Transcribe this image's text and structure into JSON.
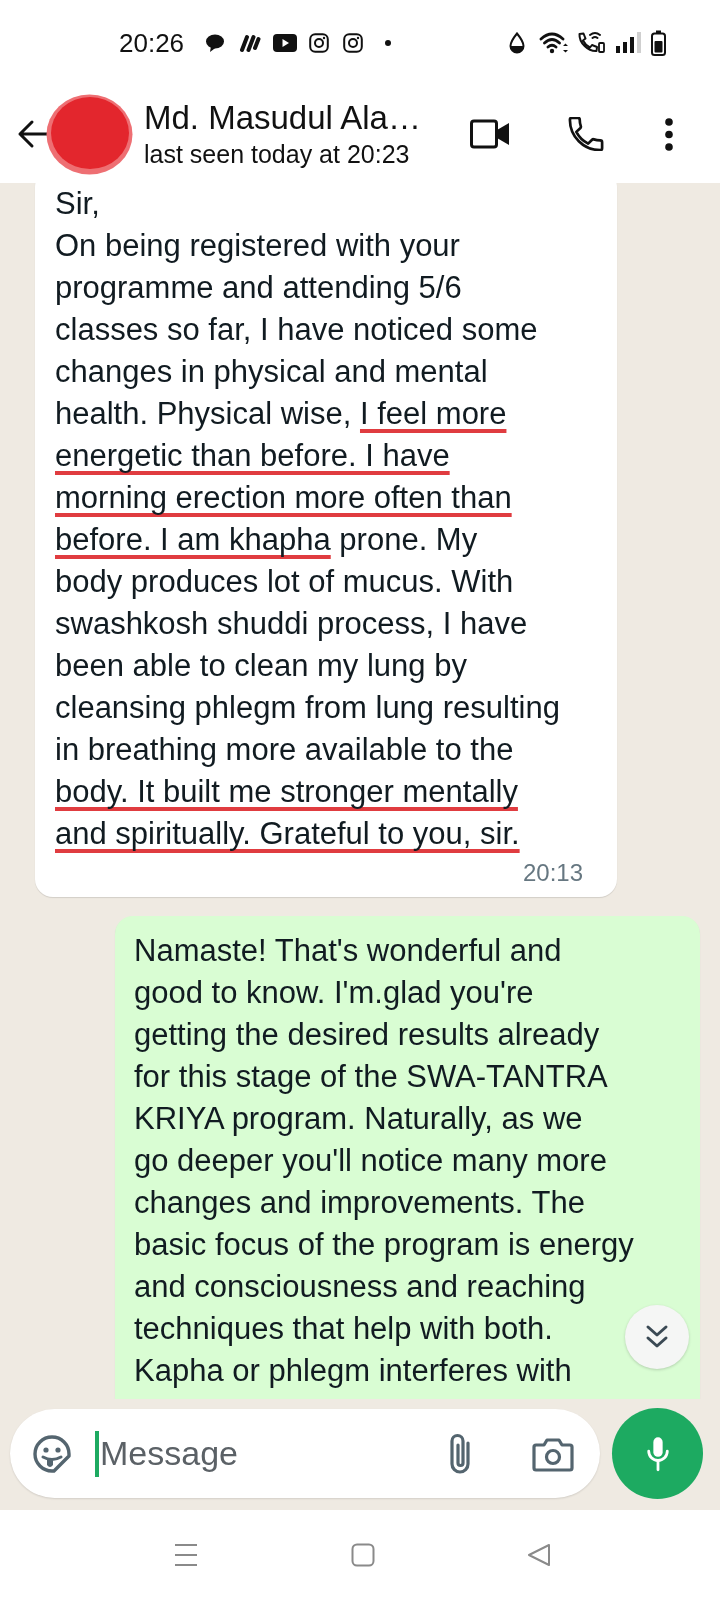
{
  "status_bar": {
    "time": "20:26"
  },
  "header": {
    "contact_name": "Md. Masudul Ala…",
    "status": "last seen today at 20:23"
  },
  "messages": [
    {
      "kind": "incoming",
      "segments": [
        {
          "text": "Sir,\nOn being registered with your\nprogramme and attending 5/6\nclasses so far, I have noticed some\nchanges in physical and mental\nhealth. Physical wise, ",
          "underlined": false
        },
        {
          "text": "I feel more\nenergetic than before. I have\nmorning erection more often than\nbefore. I am khapha",
          "underlined": true
        },
        {
          "text": " prone. My\nbody produces lot of mucus. With\nswashkosh shuddi process, I have\nbeen able to clean my lung by\ncleansing phlegm from lung resulting\nin breathing more available to the\n",
          "underlined": false
        },
        {
          "text": "body. It built me stronger mentally\nand spiritually. Grateful to you, sir.",
          "underlined": true
        }
      ],
      "time": "20:13"
    },
    {
      "kind": "outgoing",
      "segments": [
        {
          "text": "Namaste! That's wonderful and\ngood to know. I'm.glad you're\ngetting the desired results already\nfor this stage of the SWA-TANTRA\nKRIYA program. Naturally, as we\ngo deeper you'll notice many more\nchanges and improvements. The\nbasic focus of the program is energy\nand consciousness and reaching\ntechniques that help with both.\nKapha or phlegm interferes with",
          "underlined": false
        }
      ]
    }
  ],
  "composer": {
    "placeholder": "Message"
  }
}
